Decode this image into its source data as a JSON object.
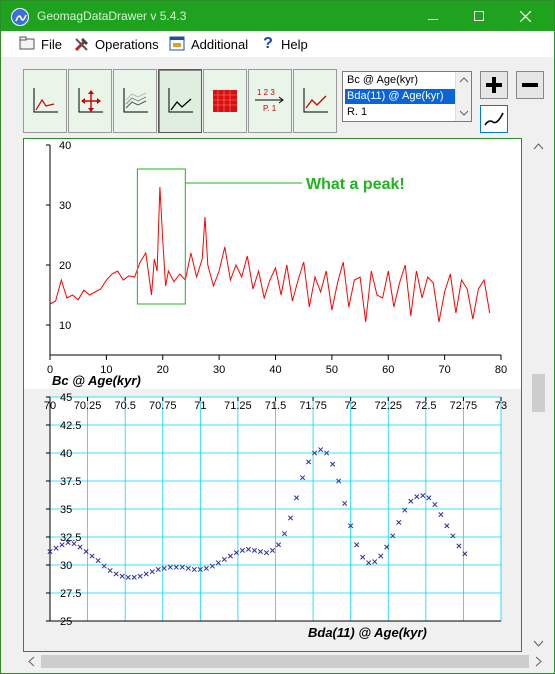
{
  "window": {
    "title": "GeomagDataDrawer v 5.4.3",
    "accent_color": "#1fa31f",
    "buttons": [
      "minimize-icon",
      "maximize-icon",
      "close-icon"
    ]
  },
  "menu": {
    "items": [
      {
        "label": "File",
        "icon": "folder-icon"
      },
      {
        "label": "Operations",
        "icon": "tools-icon"
      },
      {
        "label": "Additional",
        "icon": "window-icon"
      },
      {
        "label": "Help",
        "icon": "question-icon"
      }
    ]
  },
  "toolbar": {
    "buttons": [
      {
        "icon": "axes-plot-icon"
      },
      {
        "icon": "move-axes-icon"
      },
      {
        "icon": "multi-line-icon"
      },
      {
        "icon": "line-plot-icon",
        "active": true
      },
      {
        "icon": "red-grid-icon"
      },
      {
        "icon": "page-number-icon",
        "text": "1 2 3",
        "text2": "P. 1"
      },
      {
        "icon": "red-line-icon"
      }
    ],
    "plot_list": [
      "Bc @ Age(kyr)",
      "Bda(11) @ Age(kyr)",
      "R. 1"
    ],
    "plot_list_selected": 1,
    "add_icon": "plus-icon",
    "remove_icon": "minus-icon",
    "edit_icon": "pen-icon"
  },
  "chart_data": [
    {
      "type": "line",
      "title": "",
      "xlabel": "Bc @ Age(kyr)",
      "ylabel": "",
      "xlim": [
        0,
        80
      ],
      "ylim": [
        5,
        40
      ],
      "x_ticks": [
        0,
        10,
        20,
        30,
        40,
        50,
        60,
        70,
        80
      ],
      "y_ticks": [
        10,
        20,
        30,
        40
      ],
      "grid": false,
      "line_color": "#ff0000",
      "annotation": {
        "text": "What a peak!",
        "color": "#1eb41e",
        "x_range": [
          15.5,
          24
        ],
        "y_range": [
          13.5,
          36
        ]
      },
      "x": [
        0,
        1,
        2,
        3,
        4,
        5,
        6,
        7,
        8,
        9,
        10,
        11,
        12,
        13,
        14,
        15,
        16,
        17,
        18,
        18.5,
        19,
        19.5,
        20,
        20.5,
        21,
        22,
        23,
        24,
        25,
        26,
        27,
        27.5,
        28,
        29,
        30,
        31,
        32,
        33,
        34,
        35,
        36,
        37,
        38,
        39,
        40,
        41,
        42,
        43,
        44,
        45,
        46,
        47,
        48,
        49,
        50,
        51,
        52,
        53,
        54,
        55,
        56,
        57,
        58,
        59,
        60,
        61,
        62,
        63,
        64,
        65,
        66,
        67,
        68,
        69,
        70,
        71,
        72,
        73,
        74,
        75,
        76,
        77,
        78
      ],
      "values": [
        13.5,
        14,
        17.5,
        14.5,
        15,
        14.2,
        15.8,
        15,
        15.5,
        16,
        17.5,
        18.5,
        19,
        17.5,
        18.2,
        18,
        20.5,
        22,
        15,
        21,
        19,
        33,
        24,
        16.5,
        19,
        17.2,
        18.5,
        17.5,
        22,
        18,
        21,
        28,
        20,
        16.5,
        19,
        23,
        17.5,
        20,
        18,
        21.5,
        16,
        19,
        14.5,
        17.5,
        19.5,
        15,
        20,
        14,
        17.5,
        20.5,
        13,
        18,
        15.5,
        19,
        12.5,
        17,
        20.5,
        13,
        17.5,
        18,
        10.5,
        19,
        15,
        14.5,
        19,
        13,
        17,
        20,
        11.5,
        19,
        14.5,
        18,
        17,
        10.5,
        15.5,
        18.5,
        12,
        17.5,
        16,
        11,
        16,
        17.5,
        12
      ]
    },
    {
      "type": "scatter",
      "title": "",
      "xlabel": "Bda(11) @ Age(kyr)",
      "ylabel": "",
      "xlim": [
        70,
        73
      ],
      "ylim": [
        25,
        45
      ],
      "x_ticks": [
        70,
        70.25,
        70.5,
        70.75,
        71,
        71.25,
        71.5,
        71.75,
        72,
        72.25,
        72.5,
        72.75,
        73
      ],
      "x_tick_labels": [
        "70",
        "70.25",
        "70.5",
        "70.75",
        "71",
        "71.25",
        "71.5",
        "71.75",
        "72",
        "72.25",
        "72.5",
        "72.75",
        "73"
      ],
      "y_ticks": [
        25,
        27.5,
        30,
        32.5,
        35,
        37.5,
        40,
        42.5,
        45
      ],
      "y_tick_labels": [
        "25",
        "27.5",
        "30",
        "32.5",
        "35",
        "37.5",
        "40",
        "42.5",
        "45"
      ],
      "grid": true,
      "grid_color": "#00d8ff",
      "marker": "x",
      "marker_color": "#3030a0",
      "x": [
        70.0,
        70.04,
        70.08,
        70.12,
        70.16,
        70.2,
        70.24,
        70.28,
        70.32,
        70.36,
        70.4,
        70.44,
        70.48,
        70.52,
        70.56,
        70.6,
        70.64,
        70.68,
        70.72,
        70.76,
        70.8,
        70.84,
        70.88,
        70.92,
        70.96,
        71.0,
        71.04,
        71.08,
        71.12,
        71.16,
        71.2,
        71.24,
        71.28,
        71.32,
        71.36,
        71.4,
        71.44,
        71.48,
        71.52,
        71.56,
        71.6,
        71.64,
        71.68,
        71.72,
        71.76,
        71.8,
        71.84,
        71.88,
        71.92,
        71.96,
        72.0,
        72.04,
        72.08,
        72.12,
        72.16,
        72.2,
        72.24,
        72.28,
        72.32,
        72.36,
        72.4,
        72.44,
        72.48,
        72.52,
        72.56,
        72.6,
        72.64,
        72.68,
        72.72,
        72.76,
        72.8,
        72.84,
        72.88,
        72.92,
        72.96,
        73.0
      ],
      "values": [
        31.2,
        31.5,
        31.8,
        32.0,
        31.9,
        31.6,
        31.2,
        30.8,
        30.4,
        29.9,
        29.5,
        29.2,
        29.0,
        28.9,
        28.9,
        29.0,
        29.2,
        29.4,
        29.6,
        29.7,
        29.8,
        29.8,
        29.8,
        29.7,
        29.6,
        29.6,
        29.7,
        29.9,
        30.2,
        30.5,
        30.8,
        31.1,
        31.3,
        31.4,
        31.3,
        31.2,
        31.1,
        31.3,
        31.8,
        32.8,
        34.2,
        36.0,
        37.8,
        39.2,
        40.0,
        40.3,
        40.0,
        39.0,
        37.5,
        35.5,
        33.5,
        31.8,
        30.7,
        30.2,
        30.3,
        30.8,
        31.6,
        32.6,
        33.8,
        34.9,
        35.7,
        36.1,
        36.2,
        36.0,
        35.4,
        34.5,
        33.5,
        32.6,
        31.7,
        31.0
      ]
    }
  ]
}
